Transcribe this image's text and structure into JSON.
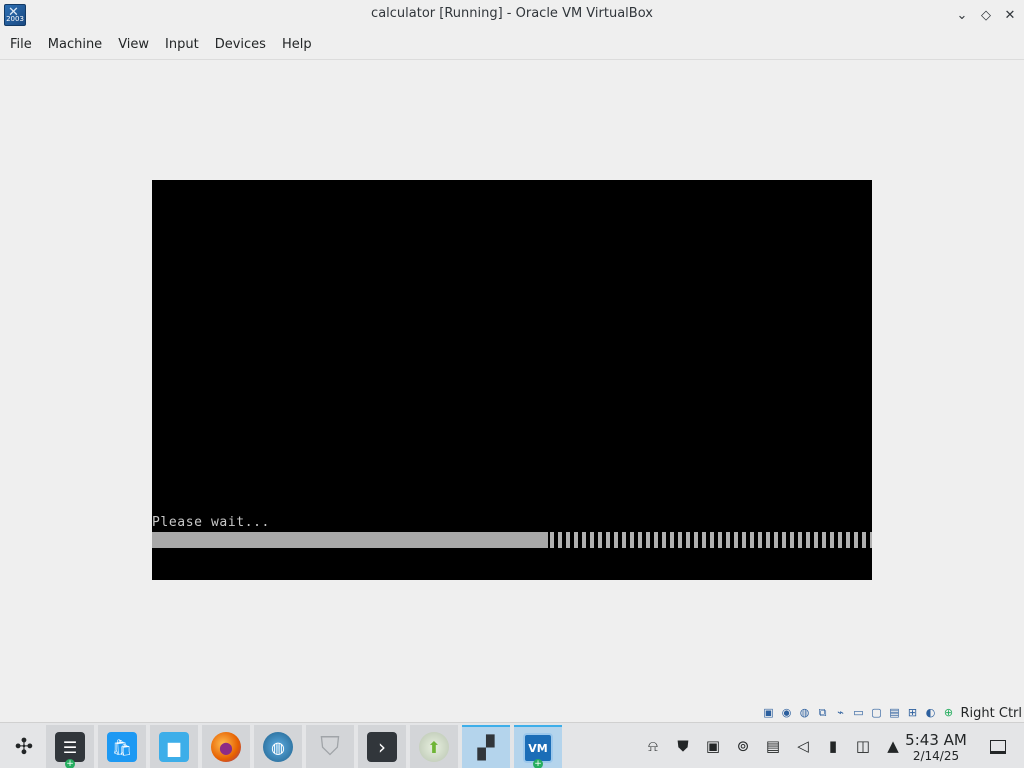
{
  "window": {
    "title": "calculator [Running] - Oracle VM VirtualBox",
    "icon_text": "2003",
    "controls": {
      "minimize": "⌄",
      "maximize": "◇",
      "close": "✕"
    }
  },
  "menu": {
    "items": [
      "File",
      "Machine",
      "View",
      "Input",
      "Devices",
      "Help"
    ]
  },
  "vm": {
    "message": "Please wait...",
    "progress_fraction": 0.55
  },
  "vbox_status": {
    "icons": [
      "hard-disk-icon",
      "optical-drive-icon",
      "audio-icon",
      "network-icon",
      "usb-icon",
      "shared-folders-icon",
      "display-icon",
      "video-capture-icon",
      "recording-icon",
      "cpu-icon",
      "mouse-integration-icon",
      "keyboard-icon"
    ],
    "host_key": "Right Ctrl"
  },
  "taskbar": {
    "apps": [
      {
        "name": "application-launcher",
        "glyph": "✣",
        "color": "#232627"
      },
      {
        "name": "system-settings",
        "glyph": "☰",
        "color": "#31363b",
        "badge": "+"
      },
      {
        "name": "discover-store",
        "glyph": "🛍",
        "color": "#1d99f3"
      },
      {
        "name": "file-manager",
        "glyph": "▆",
        "color": "#3daee9"
      },
      {
        "name": "firefox",
        "glyph": "●",
        "color": "#e66000"
      },
      {
        "name": "web-browser",
        "glyph": "◍",
        "color": "#3498db"
      },
      {
        "name": "security-shield",
        "glyph": "⛉",
        "color": "#bdc3c7"
      },
      {
        "name": "terminal",
        "glyph": "›",
        "color": "#31363b"
      },
      {
        "name": "updater",
        "glyph": "⬆",
        "color": "#6fb536"
      },
      {
        "name": "network-manager-app",
        "glyph": "▞",
        "color": "#31363b"
      },
      {
        "name": "virtualbox",
        "glyph": "VM",
        "color": "#1b6db7",
        "badge": "+"
      }
    ],
    "tray_icons": [
      "bell-icon",
      "shield-icon",
      "clipboard-icon",
      "update-icon",
      "notes-icon",
      "volume-muted-icon",
      "usb-device-icon",
      "network-icon",
      "tray-expand-icon"
    ],
    "clock": {
      "time": "5:43 AM",
      "date": "2/14/25"
    }
  }
}
